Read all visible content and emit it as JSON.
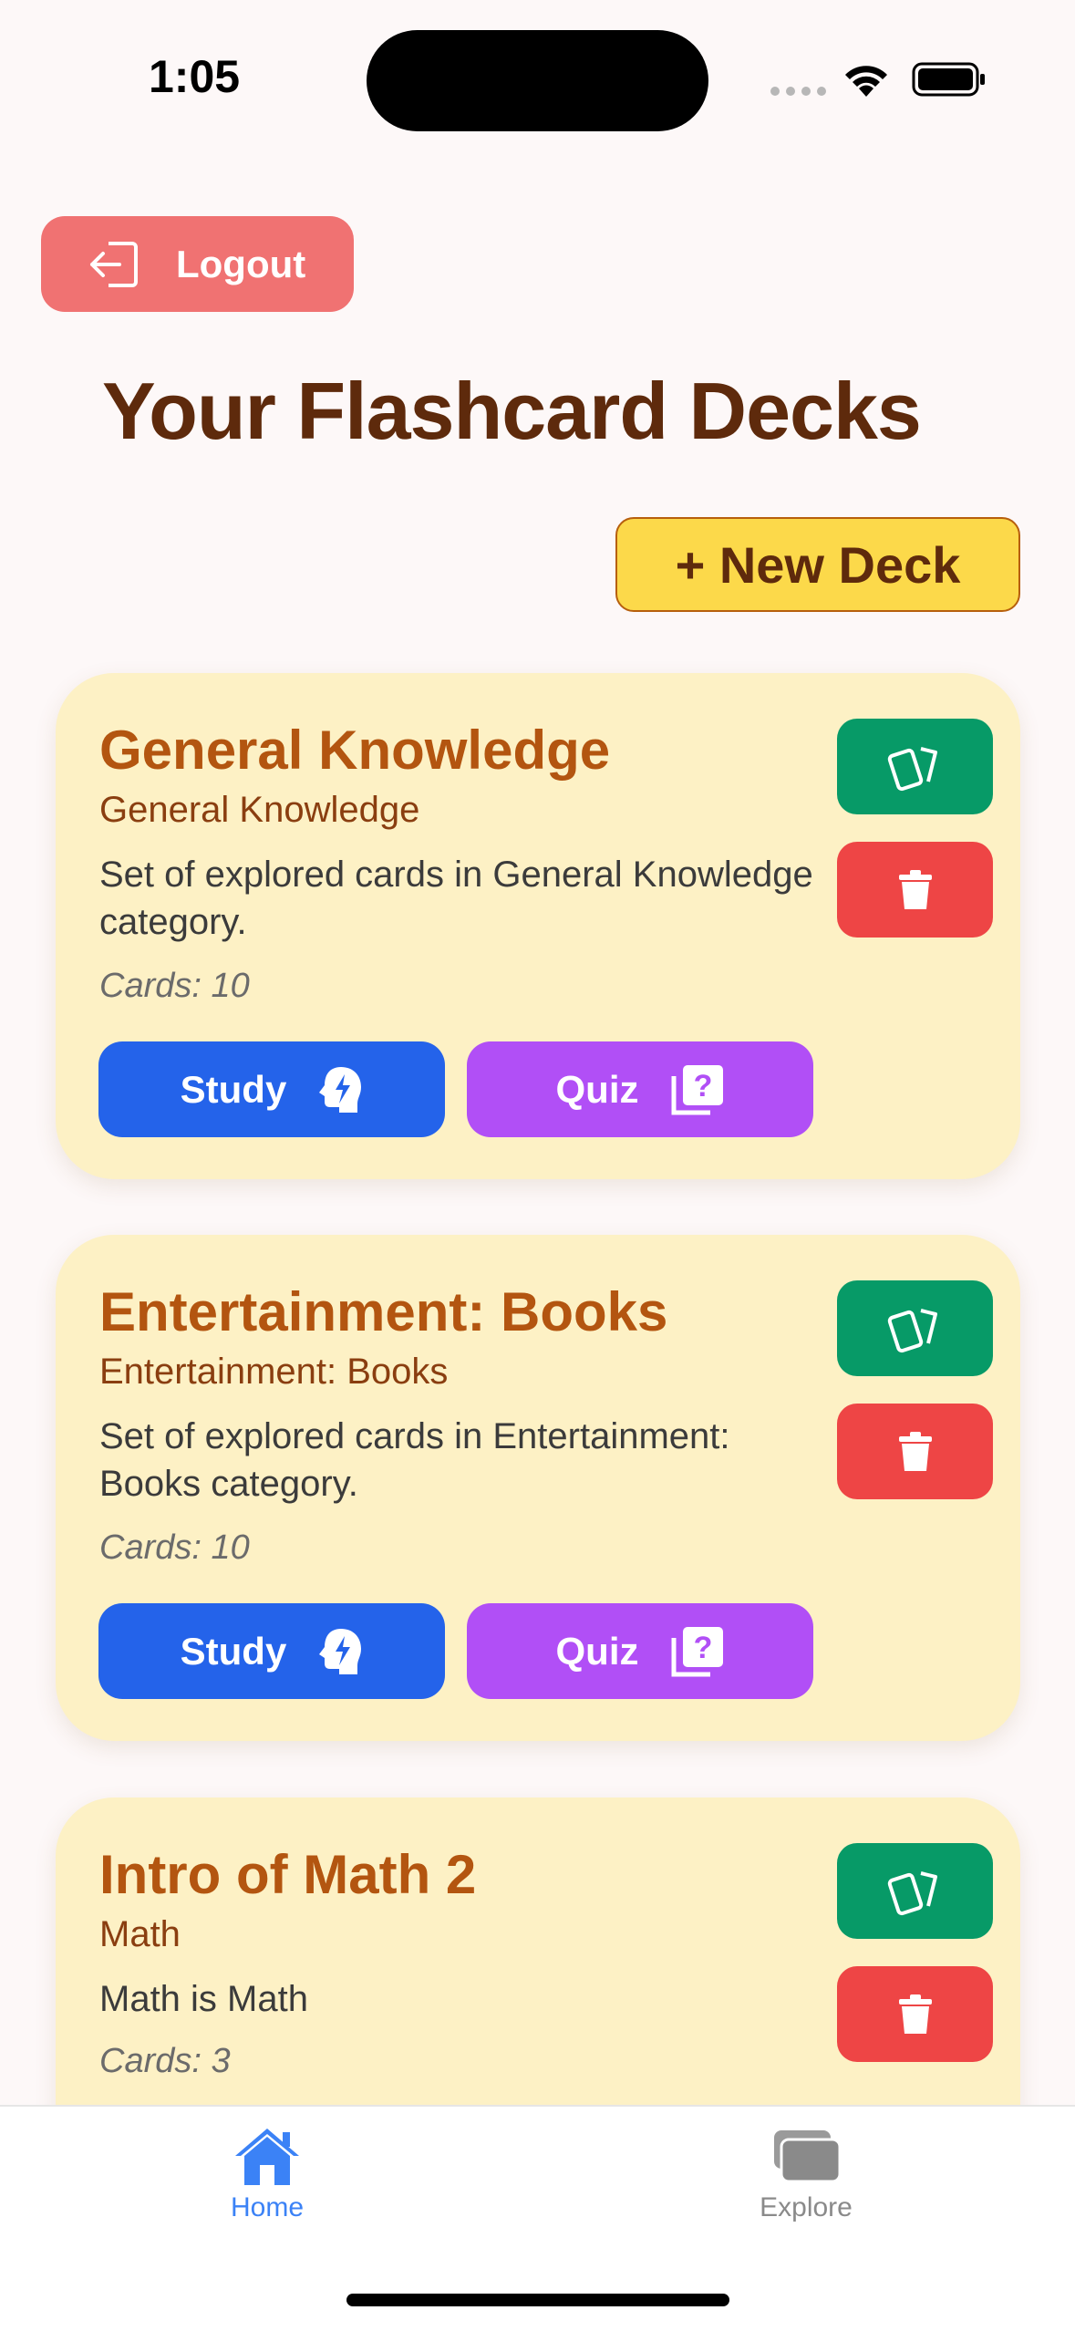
{
  "status_bar": {
    "time": "1:05"
  },
  "header": {
    "logout_label": "Logout",
    "title": "Your Flashcard Decks",
    "new_deck_label": "+ New Deck"
  },
  "decks": [
    {
      "title": "General Knowledge",
      "category": "General Knowledge",
      "description": "Set of explored cards in General Knowledge category.",
      "count": "Cards: 10",
      "study_label": "Study",
      "quiz_label": "Quiz"
    },
    {
      "title": "Entertainment: Books",
      "category": "Entertainment: Books",
      "description": "Set of explored cards in Entertainment: Books category.",
      "count": "Cards: 10",
      "study_label": "Study",
      "quiz_label": "Quiz"
    },
    {
      "title": "Intro of Math 2",
      "category": "Math",
      "description": "Math is Math",
      "count": "Cards: 3"
    }
  ],
  "tab_bar": {
    "home_label": "Home",
    "explore_label": "Explore",
    "active_color": "#3b82f6",
    "inactive_color": "#8a8a8a"
  },
  "colors": {
    "logout": "#f07272",
    "new_deck": "#fcd94a",
    "card_bg": "#fdf1c5",
    "cards_button": "#079a67",
    "delete_button": "#ee4545",
    "study_button": "#2463ea",
    "quiz_button": "#b14ff6"
  }
}
